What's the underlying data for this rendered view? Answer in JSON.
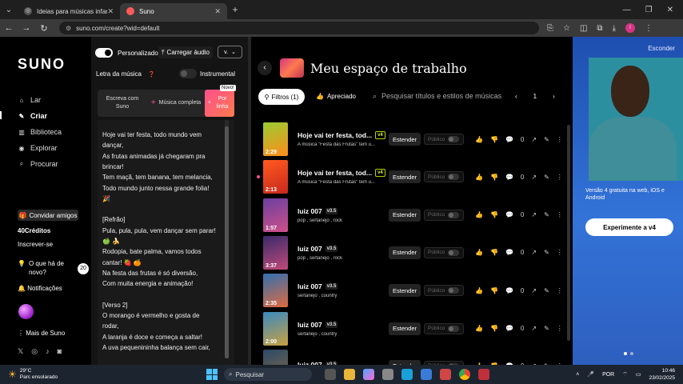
{
  "browser": {
    "tabs": [
      {
        "title": "Ideias para músicas infantis",
        "active": false
      },
      {
        "title": "Suno",
        "active": true
      }
    ],
    "url": "suno.com/create?wid=default"
  },
  "sidebar": {
    "logo": "SUNO",
    "nav": [
      {
        "label": "Lar",
        "icon": "home-icon",
        "glyph": "⌂"
      },
      {
        "label": "Criar",
        "icon": "create-icon",
        "glyph": "✎"
      },
      {
        "label": "Biblioteca",
        "icon": "library-icon",
        "glyph": "▥"
      },
      {
        "label": "Explorar",
        "icon": "explore-icon",
        "glyph": "◉"
      },
      {
        "label": "Procurar",
        "icon": "search-icon",
        "glyph": "⌕"
      }
    ],
    "invite": "Convidar amigos",
    "credits": "40Créditos",
    "subscribe": "Inscrever-se",
    "news": "O que há de novo?",
    "news_count": "20",
    "notifications": "Notificações",
    "more": "Mais de Suno"
  },
  "create": {
    "custom_label": "Personalizado",
    "upload_label": "Carregar áudio",
    "version_label": "v.",
    "lyrics_label": "Letra da música",
    "instrumental_label": "Instrumental",
    "modes": [
      "Escreva com Suno",
      "Música completa",
      "Por linha"
    ],
    "new_badge": "Novo!",
    "lyrics": [
      "Hoje vai ter festa, todo mundo vem",
      "dançar,",
      "As frutas animadas já chegaram pra",
      "brincar!",
      "Tem maçã, tem banana, tem melancia,",
      "Todo mundo junto nessa grande folia!",
      "🎉",
      "",
      "[Refrão]",
      "Pula, pula, pula, vem dançar sem parar!",
      "🍏 🍌",
      "Rodopia, bate palma, vamos todos",
      "cantar! 🍓 🍊",
      "Na festa das frutas é só diversão,",
      "Com muita energia e animação!",
      "",
      "[Verso 2]",
      "O morango é vermelho e gosta de",
      "rodar,",
      "A laranja é doce e começa a saltar!",
      "A uva pequenininha balança sem cair,"
    ]
  },
  "workspace": {
    "title": "Meu espaço de trabalho",
    "filters_label": "Filtros (1)",
    "liked_label": "Apreciado",
    "search_placeholder": "Pesquisar títulos e estilos de músicas",
    "page": "1",
    "extend_label": "Estender",
    "public_label": "Público",
    "songs": [
      {
        "title": "Hoje vai ter festa, tod...",
        "version": "v4",
        "desc": "A música \"Festa das Frutas\" tem u...",
        "duration": "2:29",
        "likes": "0",
        "colors": [
          "#9acd32",
          "#ff8c1a"
        ],
        "unread": false
      },
      {
        "title": "Hoje vai ter festa, tod...",
        "version": "v4",
        "desc": "A música \"Festa das Frutas\" tem u...",
        "duration": "2:13",
        "likes": "0",
        "colors": [
          "#ff5a1f",
          "#c8281e"
        ],
        "unread": true
      },
      {
        "title": "luiz 007",
        "version": "v3.5",
        "desc": "pop , sertanejo , rock",
        "duration": "1:57",
        "likes": "0",
        "colors": [
          "#6a3fa0",
          "#d0508a"
        ],
        "unread": false
      },
      {
        "title": "luiz 007",
        "version": "v3.5",
        "desc": "pop , sertanejo , rock",
        "duration": "3:37",
        "likes": "0",
        "colors": [
          "#3a2a6a",
          "#c04a7a"
        ],
        "unread": false
      },
      {
        "title": "luiz 007",
        "version": "v3.5",
        "desc": "sertanejo , country",
        "duration": "2:35",
        "likes": "0",
        "colors": [
          "#3070b0",
          "#e06a40"
        ],
        "unread": false
      },
      {
        "title": "luiz 007",
        "version": "v3.5",
        "desc": "sertanejo , country",
        "duration": "2:00",
        "likes": "0",
        "colors": [
          "#3a8ac0",
          "#c8a040"
        ],
        "unread": false
      },
      {
        "title": "luiz 007",
        "version": "v3.5",
        "desc": "",
        "duration": "",
        "likes": "0",
        "colors": [
          "#2a4a6a",
          "#8a6a40"
        ],
        "unread": false
      }
    ]
  },
  "ad": {
    "close_label": "Esconder",
    "text_line1": "Versão 4 gratuita na web, iOS e",
    "text_line2": "Android",
    "cta": "Experimente a v4"
  },
  "taskbar": {
    "temperature": "29°C",
    "weather": "Parc ensolarado",
    "search": "Pesquisar",
    "language": "POR",
    "time": "10:46",
    "date": "23/02/2025"
  }
}
